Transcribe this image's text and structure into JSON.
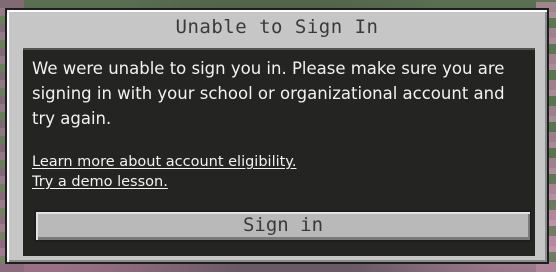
{
  "dialog": {
    "title": "Unable to Sign In",
    "message": "We were unable to sign you in. Please make sure you are signing in with your school or organizational account and try again.",
    "links": [
      "Learn more about account eligibility.",
      "Try a demo lesson."
    ],
    "button_label": "Sign in"
  }
}
